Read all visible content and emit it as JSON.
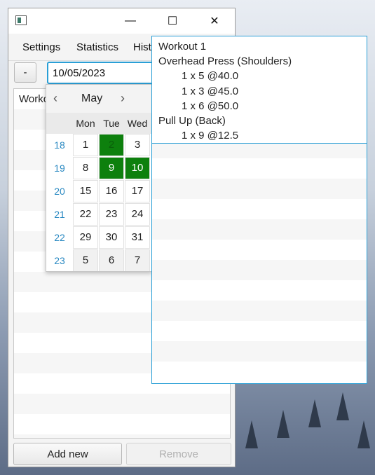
{
  "window": {
    "controls": {
      "minimize": "—",
      "maximize": "☐",
      "close": "✕"
    }
  },
  "menu": [
    "Settings",
    "Statistics",
    "Hist"
  ],
  "toolbar": {
    "minus_label": "-",
    "date_value": "10/05/2023"
  },
  "list": {
    "header": "Worko"
  },
  "buttons": {
    "add_new": "Add new",
    "remove": "Remove"
  },
  "calendar": {
    "month": "May",
    "prev": "‹",
    "next": "›",
    "weekdays": [
      "Mon",
      "Tue",
      "Wed"
    ],
    "weeks": [
      {
        "week": "18",
        "days": [
          "1",
          "2",
          "3"
        ]
      },
      {
        "week": "19",
        "days": [
          "8",
          "9",
          "10"
        ]
      },
      {
        "week": "20",
        "days": [
          "15",
          "16",
          "17"
        ]
      },
      {
        "week": "21",
        "days": [
          "22",
          "23",
          "24"
        ]
      },
      {
        "week": "22",
        "days": [
          "29",
          "30",
          "31"
        ]
      },
      {
        "week": "23",
        "days": [
          "5",
          "6",
          "7"
        ]
      }
    ]
  },
  "detail": {
    "title": "Workout 1",
    "exercises": [
      {
        "name": "Overhead Press (Shoulders)",
        "sets": [
          "1 x 5 @40.0",
          "1 x 3 @45.0",
          "1 x 6 @50.0"
        ]
      },
      {
        "name": "Pull Up (Back)",
        "sets": [
          "1 x 9 @12.5"
        ]
      }
    ]
  },
  "colors": {
    "accent": "#2a9fd6",
    "highlight": "#0d800d",
    "week_number": "#2a89c2"
  }
}
